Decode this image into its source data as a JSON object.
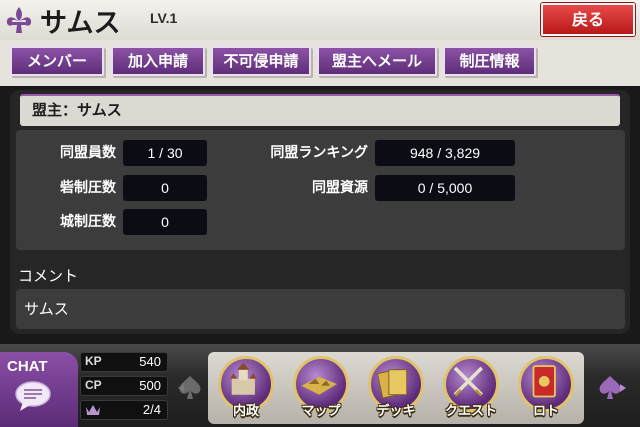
{
  "header": {
    "title": "サムス",
    "level": "LV.1",
    "back_label": "戻る"
  },
  "tabs": [
    {
      "label": "メンバー"
    },
    {
      "label": "加入申請"
    },
    {
      "label": "不可侵申請"
    },
    {
      "label": "盟主へメール"
    },
    {
      "label": "制圧情報"
    }
  ],
  "panel": {
    "leader": "盟主：サムス",
    "stats": {
      "members_label": "同盟員数",
      "members_value": "1 / 30",
      "fort_label": "砦制圧数",
      "fort_value": "0",
      "castle_label": "城制圧数",
      "castle_value": "0",
      "ranking_label": "同盟ランキング",
      "ranking_value": "948 / 3,829",
      "resources_label": "同盟資源",
      "resources_value": "0 / 5,000"
    },
    "comment_label": "コメント",
    "comment_text": "サムス"
  },
  "bottom": {
    "chat_label": "CHAT",
    "kp_label": "KP",
    "kp_value": "540",
    "cp_label": "CP",
    "cp_value": "500",
    "deck_value": "2/4",
    "menu": [
      {
        "label": "内政",
        "icon": "castle-icon"
      },
      {
        "label": "マップ",
        "icon": "map-icon"
      },
      {
        "label": "デッキ",
        "icon": "cards-icon"
      },
      {
        "label": "クエスト",
        "icon": "swords-icon"
      },
      {
        "label": "ロト",
        "icon": "lotto-card-icon"
      }
    ]
  },
  "colors": {
    "accent_purple": "#6b3789",
    "back_red": "#d42f2f",
    "gold": "#e0c36a"
  }
}
